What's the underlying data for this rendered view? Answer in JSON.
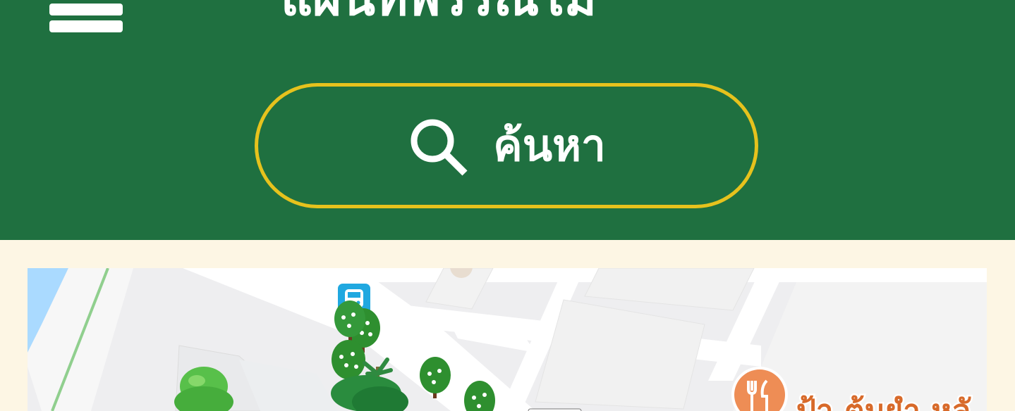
{
  "header": {
    "title": "แผนที่พรรณไม้",
    "menu_icon": "hamburger-menu-icon",
    "colors": {
      "background": "#1f7040",
      "text": "#ffffff",
      "search_border": "#e6c21d"
    }
  },
  "search": {
    "label": "ค้นหา",
    "icon": "search-icon"
  },
  "map": {
    "bus_stop_icon": "bus-stop-icon",
    "tree_icon": "tree-icon",
    "restaurant_icon": "restaurant-icon",
    "restaurant_label": "ป้า ต้มยำ หลั",
    "colors": {
      "page_background": "#fdf6e4",
      "restaurant": "#ee8d55",
      "bus": "#20a8e0"
    }
  }
}
